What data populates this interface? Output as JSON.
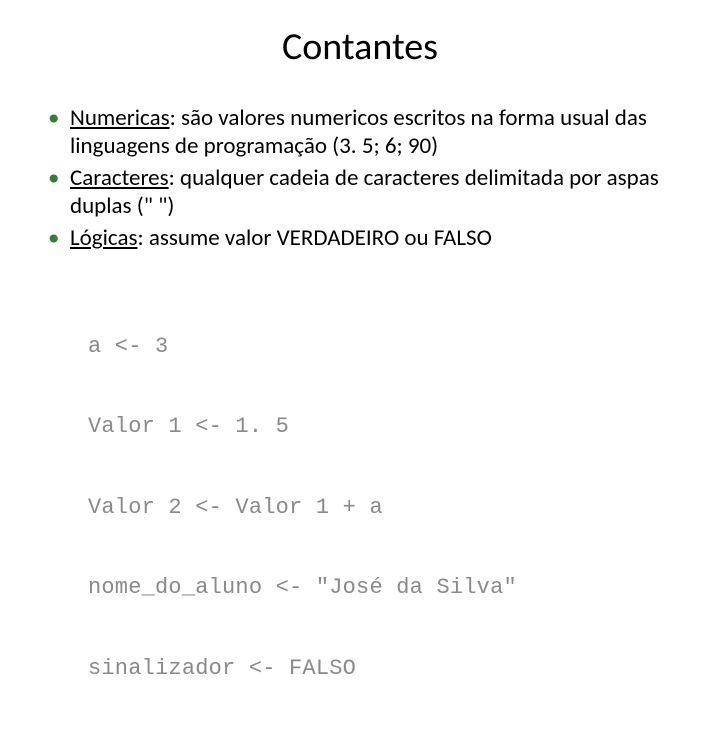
{
  "title": "Contantes",
  "bullets": [
    {
      "term": "Numericas",
      "sep": ": ",
      "rest": "são valores numericos escritos na forma usual das linguagens de programação (3. 5; 6; 90)"
    },
    {
      "term": "Caracteres",
      "sep": ": ",
      "rest": "qualquer cadeia de caracteres delimitada por aspas duplas (\"  \")"
    },
    {
      "term": "Lógicas",
      "sep": ": ",
      "rest": "assume valor VERDADEIRO ou FALSO"
    }
  ],
  "code_lines": [
    "a <- 3",
    "Valor 1 <- 1. 5",
    "Valor 2 <- Valor 1 + a",
    "nome_do_aluno <- \"José da Silva\"",
    "sinalizador <- FALSO"
  ]
}
